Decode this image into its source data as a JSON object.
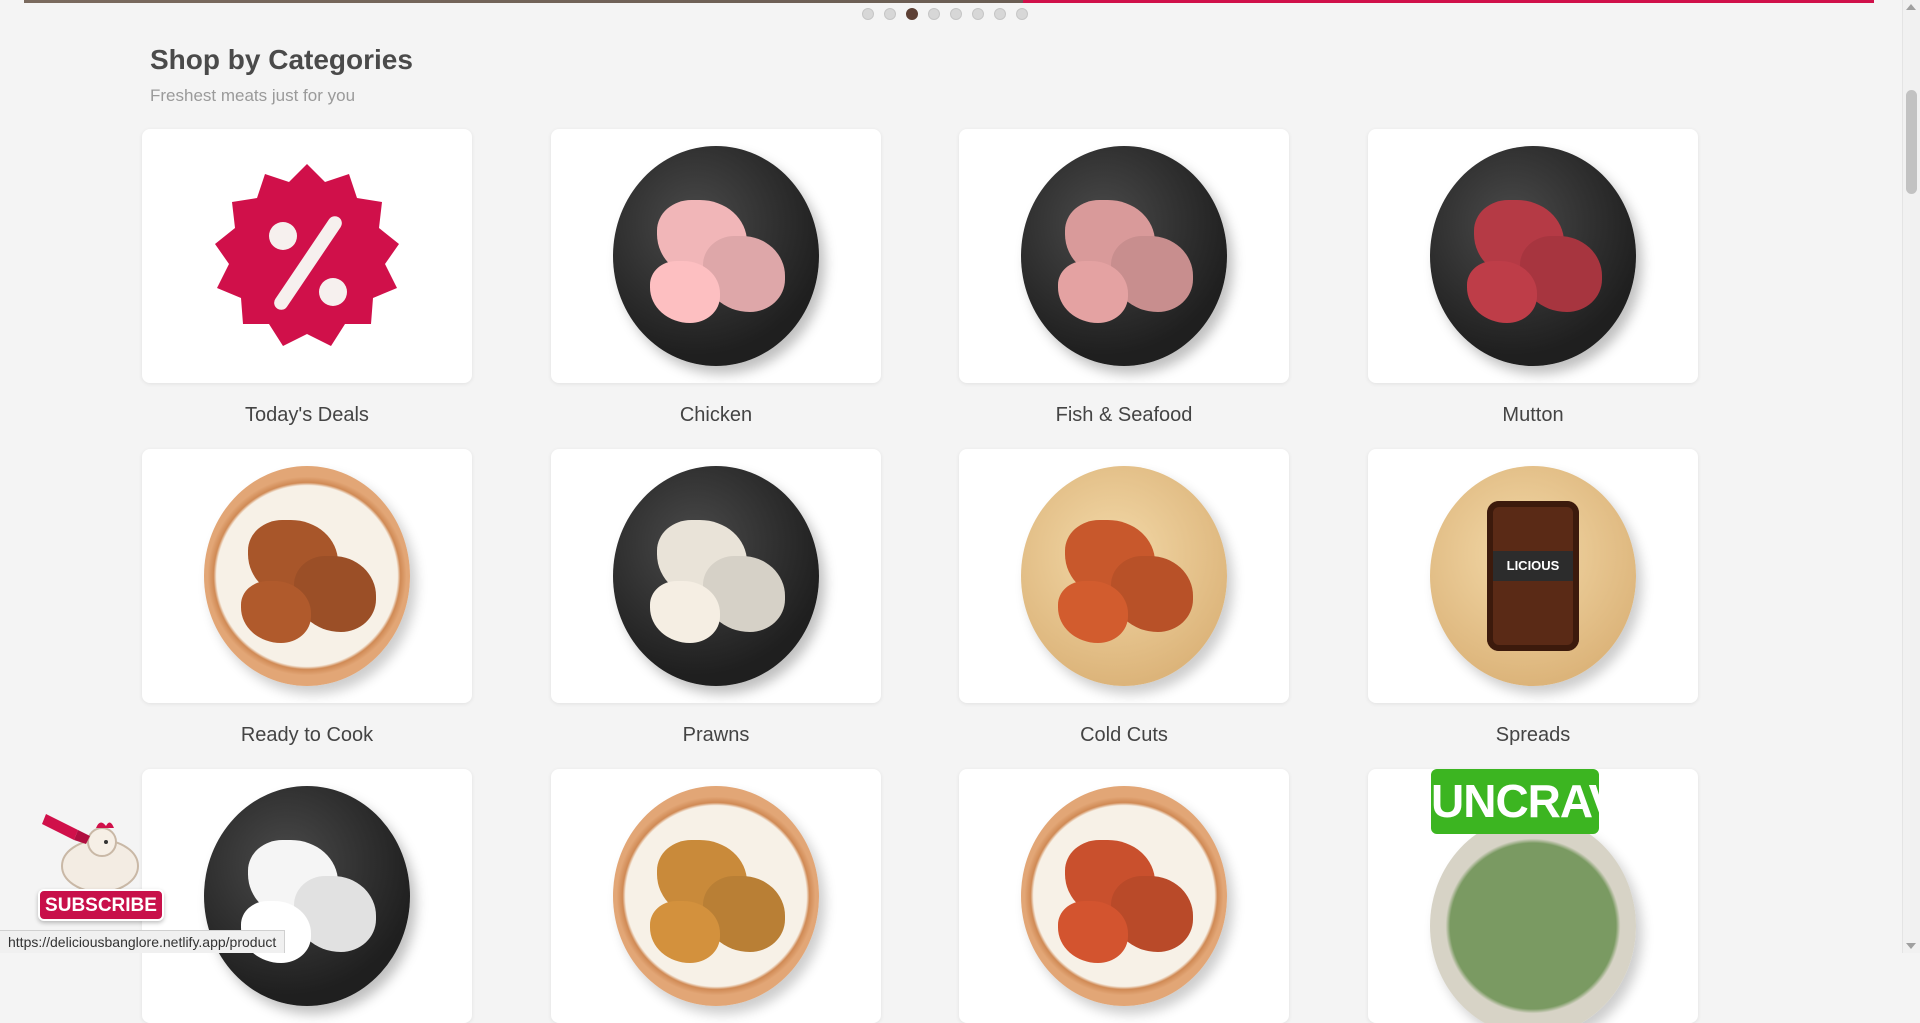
{
  "carousel": {
    "dot_count": 8,
    "active_index": 2
  },
  "section": {
    "title": "Shop by Categories",
    "subtitle": "Freshest meats just for you"
  },
  "categories": [
    {
      "label": "Today's Deals",
      "icon": "deals-badge-icon",
      "visual": "badge"
    },
    {
      "label": "Chicken",
      "icon": "chicken-plate-icon",
      "visual": "dark"
    },
    {
      "label": "Fish & Seafood",
      "icon": "fish-plate-icon",
      "visual": "dark"
    },
    {
      "label": "Mutton",
      "icon": "mutton-plate-icon",
      "visual": "dark"
    },
    {
      "label": "Ready to Cook",
      "icon": "ready-to-cook-plate-icon",
      "visual": "ceramic"
    },
    {
      "label": "Prawns",
      "icon": "prawns-plate-icon",
      "visual": "dark"
    },
    {
      "label": "Cold Cuts",
      "icon": "cold-cuts-plate-icon",
      "visual": "wood"
    },
    {
      "label": "Spreads",
      "icon": "spreads-plate-icon",
      "visual": "wood"
    },
    {
      "label": "",
      "icon": "eggs-plate-icon",
      "visual": "dark"
    },
    {
      "label": "",
      "icon": "biryani-plate-icon",
      "visual": "ceramic"
    },
    {
      "label": "",
      "icon": "kebab-plate-icon",
      "visual": "ceramic"
    },
    {
      "label": "",
      "icon": "uncrave-plate-icon",
      "visual": "uncrave"
    }
  ],
  "uncrave_logo": "UNCRAVE",
  "jar_label": "LICIOUS",
  "subscribe": {
    "label": "SUBSCRIBE"
  },
  "status_url": "https://deliciousbanglore.netlify.app/product",
  "colors": {
    "brand": "#d0104a",
    "background": "#f4f4f4",
    "active_dot": "#5d4035"
  }
}
